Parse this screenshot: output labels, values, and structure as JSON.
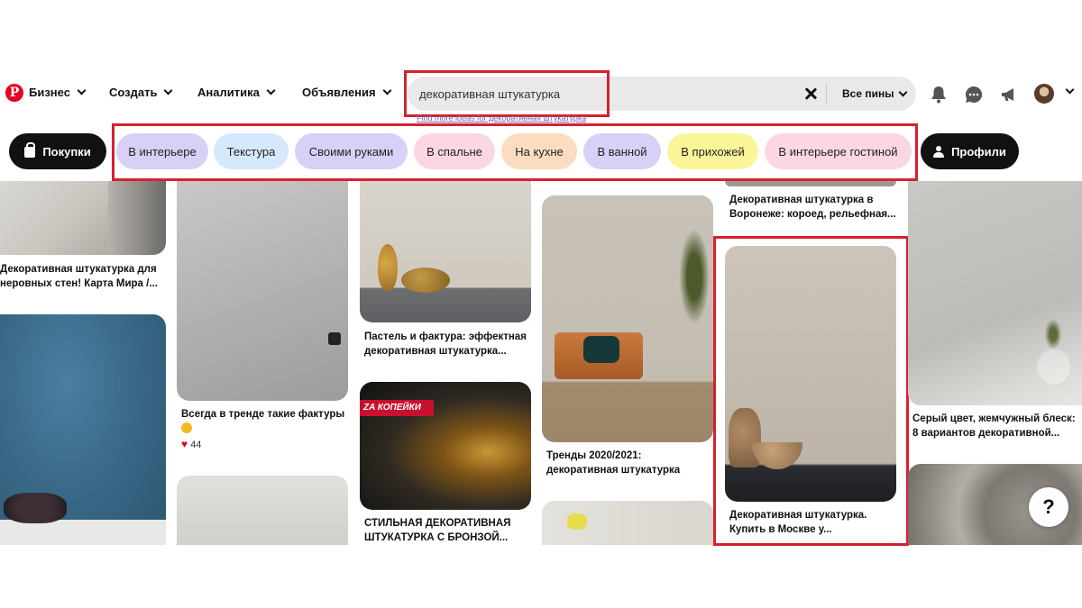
{
  "nav": {
    "items": [
      {
        "label": "Бизнес"
      },
      {
        "label": "Создать"
      },
      {
        "label": "Аналитика"
      },
      {
        "label": "Объявления"
      }
    ],
    "search": {
      "value": "декоративная штукатурка",
      "scope": "Все пины"
    },
    "hint": "Find more ideas for декоративная штукатурка"
  },
  "filters": {
    "shop": "Покупки",
    "chips": [
      {
        "label": "В интерьере",
        "color": "#d8d0f6"
      },
      {
        "label": "Текстура",
        "color": "#d6e8fb"
      },
      {
        "label": "Своими руками",
        "color": "#d8d0f6"
      },
      {
        "label": "В спальне",
        "color": "#fad7e2"
      },
      {
        "label": "На кухне",
        "color": "#fbdcc0"
      },
      {
        "label": "В ванной",
        "color": "#d8d0f6"
      },
      {
        "label": "В прихожей",
        "color": "#fbf59a"
      },
      {
        "label": "В интерьере гостиной",
        "color": "#fad7e2"
      }
    ],
    "profiles": "Профили"
  },
  "pins": {
    "col1": {
      "title1": "Декоративная штукатурка для",
      "title2": "неровных стен! Карта Мира /..."
    },
    "col2": {
      "title1": "Всегда в тренде такие фактуры",
      "likes": "44"
    },
    "col3": {
      "title1": "Пастель и фактура: эффектная",
      "title2": "декоративная штукатурка...",
      "banner": "ZA КОПЕЙКИ",
      "title3": "СТИЛЬНАЯ ДЕКОРАТИВНАЯ",
      "title4": "ШТУКАТУРКА С БРОНЗОЙ..."
    },
    "col4": {
      "title1": "Тренды 2020/2021:",
      "title2": "декоративная штукатурка"
    },
    "col5": {
      "top1": "Декоративная штукатурка в",
      "top2": "Воронеже: короед, рельефная...",
      "title1": "Декоративная штукатурка.",
      "title2": "Купить в Москве у..."
    },
    "col6": {
      "title1": "Серый цвет, жемчужный блеск:",
      "title2": "8 вариантов декоративной..."
    }
  },
  "help": "?",
  "colors": {
    "accent": "#e60023",
    "highlight": "#d4222f"
  }
}
